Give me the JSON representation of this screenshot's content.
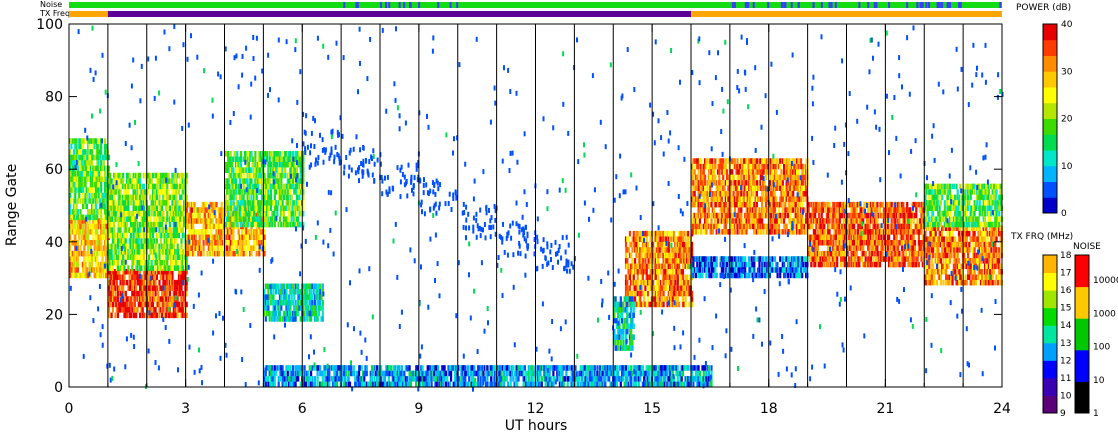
{
  "strip_labels": {
    "noise": "Noise",
    "tx_freq": "TX Freq"
  },
  "colorbars": {
    "power": {
      "title": "POWER (dB)",
      "ticks": [
        "40",
        "30",
        "20",
        "10",
        "0"
      ]
    },
    "tx_freq": {
      "title": "TX FRQ (MHz)",
      "ticks": [
        "18",
        "17",
        "16",
        "15",
        "14",
        "13",
        "12",
        "11",
        "10",
        "9"
      ]
    },
    "noise": {
      "title": "NOISE",
      "ticks": [
        "10000",
        "1000",
        "100",
        "10",
        "1"
      ]
    }
  },
  "colors": {
    "power_scale": [
      "#0000c8",
      "#0050ff",
      "#00b4ff",
      "#00e6c8",
      "#00dc50",
      "#3cdc00",
      "#b4e600",
      "#ffff00",
      "#ffc800",
      "#ff8c00",
      "#ff3c00",
      "#e60000"
    ],
    "tx_freq_scale": [
      "#000000",
      "#5a0078",
      "#3c00b4",
      "#0000ff",
      "#00a0ff",
      "#00e6a0",
      "#00dc00",
      "#a0e600",
      "#ffff00",
      "#ffb400",
      "#ff6400",
      "#ff0000"
    ],
    "noise_scale": [
      "#000000",
      "#0000ff",
      "#00c800",
      "#ffc800",
      "#ff0000"
    ],
    "noise_strip": "#14dc14",
    "noise_strip_high": "#3c3cff",
    "txfreq_strip_day": "#ffa500",
    "txfreq_strip_night": "#5a0096"
  },
  "chart_data": {
    "type": "heatmap",
    "title": "",
    "xlabel": "UT hours",
    "ylabel": "Range Gate",
    "xlim": [
      0,
      24
    ],
    "ylim": [
      0,
      100
    ],
    "x_ticks": [
      "0",
      "3",
      "6",
      "9",
      "12",
      "15",
      "18",
      "21",
      "24"
    ],
    "y_ticks": [
      "0",
      "20",
      "40",
      "60",
      "80",
      "100"
    ],
    "scan_boundaries_hours": [
      1,
      2,
      3,
      4,
      5,
      6,
      7,
      8,
      9,
      10,
      11,
      12,
      13,
      14,
      15,
      16,
      17,
      18,
      19,
      20,
      21,
      22,
      23
    ],
    "power_db_range": [
      0,
      40
    ],
    "tx_freq_strip": [
      {
        "from": 0,
        "to": 1,
        "mhz": 15.5
      },
      {
        "from": 1,
        "to": 16,
        "mhz": 10.5
      },
      {
        "from": 16,
        "to": 24,
        "mhz": 15.5
      }
    ],
    "echo_regions": [
      {
        "x0": 0.0,
        "x1": 1.0,
        "y0": 30,
        "y1": 46,
        "power": 28
      },
      {
        "x0": 0.0,
        "x1": 1.0,
        "y0": 46,
        "y1": 68,
        "power": 18
      },
      {
        "x0": 1.0,
        "x1": 3.0,
        "y0": 19,
        "y1": 32,
        "power": 36
      },
      {
        "x0": 1.0,
        "x1": 3.0,
        "y0": 32,
        "y1": 58,
        "power": 20
      },
      {
        "x0": 3.0,
        "x1": 5.0,
        "y0": 36,
        "y1": 50,
        "power": 30
      },
      {
        "x0": 4.0,
        "x1": 6.0,
        "y0": 44,
        "y1": 64,
        "power": 18
      },
      {
        "x0": 5.0,
        "x1": 6.5,
        "y0": 18,
        "y1": 28,
        "power": 12
      },
      {
        "x0": 14.3,
        "x1": 16.0,
        "y0": 22,
        "y1": 42,
        "power": 32
      },
      {
        "x0": 14.0,
        "x1": 14.5,
        "y0": 10,
        "y1": 25,
        "power": 12
      },
      {
        "x0": 16.0,
        "x1": 19.0,
        "y0": 42,
        "y1": 62,
        "power": 32
      },
      {
        "x0": 16.0,
        "x1": 19.0,
        "y0": 30,
        "y1": 36,
        "power": 6
      },
      {
        "x0": 19.0,
        "x1": 22.0,
        "y0": 33,
        "y1": 50,
        "power": 34
      },
      {
        "x0": 22.0,
        "x1": 24.0,
        "y0": 28,
        "y1": 44,
        "power": 32
      },
      {
        "x0": 22.0,
        "x1": 24.0,
        "y0": 44,
        "y1": 55,
        "power": 18
      },
      {
        "x0": 5.0,
        "x1": 16.5,
        "y0": 0,
        "y1": 6,
        "power": 8
      }
    ],
    "scatter_trail": [
      {
        "x": 6.5,
        "y": 66
      },
      {
        "x": 7.5,
        "y": 62
      },
      {
        "x": 8.5,
        "y": 58
      },
      {
        "x": 9.5,
        "y": 53
      },
      {
        "x": 10.5,
        "y": 46
      },
      {
        "x": 11.5,
        "y": 41
      },
      {
        "x": 12.5,
        "y": 37
      }
    ]
  }
}
